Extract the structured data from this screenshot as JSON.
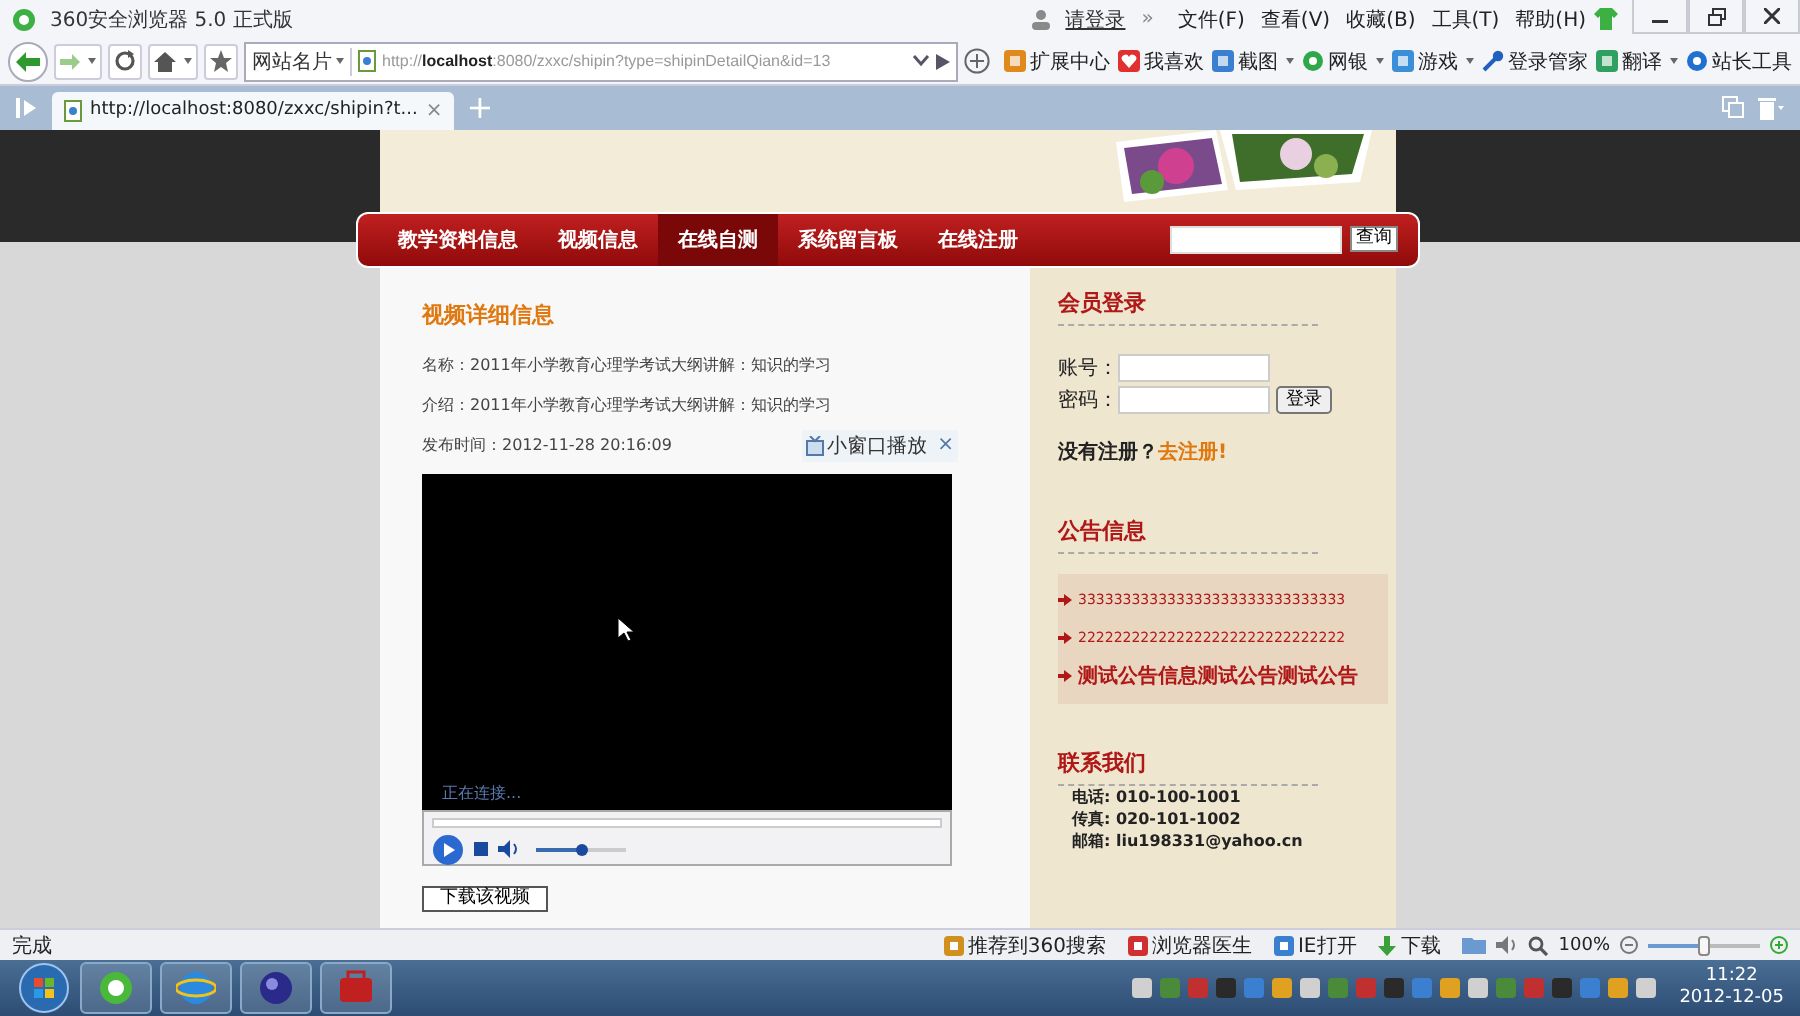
{
  "window": {
    "title": "360安全浏览器 5.0 正式版",
    "login_link": "请登录",
    "more": "»",
    "menu": [
      "文件(F)",
      "查看(V)",
      "收藏(B)",
      "工具(T)",
      "帮助(H)"
    ]
  },
  "toolbar": {
    "site_card": "网站名片",
    "address": "http://**localhost**:8080/zxxc/shipin?type=shipinDetailQian&id=13",
    "extensions": [
      {
        "label": "扩展中心",
        "dropdown": false
      },
      {
        "label": "我喜欢",
        "dropdown": false
      },
      {
        "label": "截图",
        "dropdown": true
      },
      {
        "label": "网银",
        "dropdown": true
      },
      {
        "label": "游戏",
        "dropdown": true
      },
      {
        "label": "登录管家",
        "dropdown": false
      },
      {
        "label": "翻译",
        "dropdown": true
      },
      {
        "label": "站长工具",
        "dropdown": false
      }
    ]
  },
  "tabs": [
    {
      "title": "http://localhost:8080/zxxc/shipin?t...",
      "selected": true,
      "close": "×"
    }
  ],
  "new_tab": "+",
  "site": {
    "nav": [
      {
        "label": "教学资料信息",
        "selected": false
      },
      {
        "label": "视频信息",
        "selected": false
      },
      {
        "label": "在线自测",
        "selected": true
      },
      {
        "label": "系统留言板",
        "selected": false
      },
      {
        "label": "在线注册",
        "selected": false
      }
    ],
    "search_button": "查询"
  },
  "video": {
    "heading": "视频详细信息",
    "fields": [
      "名称：2011年小学教育心理学考试大纲讲解：知识的学习",
      "介绍：2011年小学教育心理学考试大纲讲解：知识的学习",
      "发布时间：2012-11-28 20:16:09"
    ],
    "popout": "小窗口播放",
    "popout_close": "×",
    "player_status": "正在连接...",
    "volume": {
      "level": 0.5
    },
    "download_button": "下载该视频"
  },
  "sidebar": {
    "login": {
      "title": "会员登录",
      "account_label": "账号：",
      "password_label": "密码：",
      "button": "登录",
      "register_prompt": "没有注册？",
      "register_link": "去注册!"
    },
    "notices": {
      "title": "公告信息",
      "items": [
        "333333333333333333333333333333",
        "222222222222222222222222222222",
        "测试公告信息测试公告测试公告"
      ]
    },
    "contact": {
      "title": "联系我们",
      "lines": [
        "电话: 010-100-1001",
        "传真: 020-101-1002",
        "邮箱: liu198331@yahoo.cn"
      ]
    }
  },
  "status_bar": {
    "text": "完成",
    "items": [
      "推荐到360搜索",
      "浏览器医生",
      "IE打开",
      "下载"
    ],
    "zoom": "100%",
    "zoom_slider": {
      "level": 0.5
    }
  },
  "taskbar": {
    "time": "11:22",
    "date": "2012-12-05"
  }
}
